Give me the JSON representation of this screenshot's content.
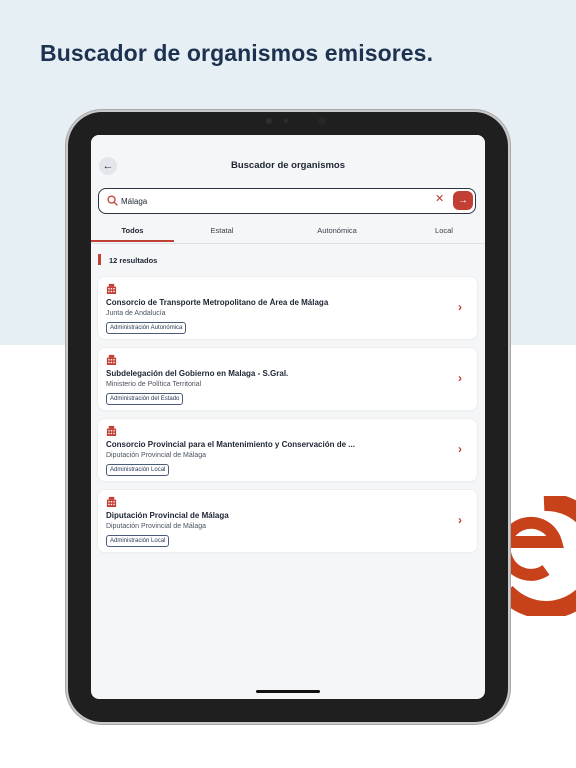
{
  "headline": "Buscador de organismos emisores.",
  "app": {
    "title": "Buscador de organismos",
    "back_icon": "arrow-left-icon"
  },
  "search": {
    "value": "Málaga",
    "placeholder": "",
    "search_icon": "search-icon",
    "clear_icon": "close-icon",
    "go_icon": "arrow-right-icon"
  },
  "tabs": [
    {
      "label": "Todos",
      "active": true
    },
    {
      "label": "Estatal",
      "active": false
    },
    {
      "label": "Autonómica",
      "active": false
    },
    {
      "label": "Local",
      "active": false
    }
  ],
  "results": {
    "count_label": "12 resultados",
    "items": [
      {
        "title": "Consorcio de Transporte Metropolitano de Área de Málaga",
        "subtitle": "Junta de Andalucía",
        "badge": "Administración Autonómica"
      },
      {
        "title": "Subdelegación del Gobierno en Malaga - S.Gral.",
        "subtitle": "Ministerio de Política Territorial",
        "badge": "Administración del Estado"
      },
      {
        "title": "Consorcio Provincial para el Mantenimiento y Conservación de ...",
        "subtitle": "Diputación Provincial de Málaga",
        "badge": "Administración Local"
      },
      {
        "title": "Diputación Provincial de Málaga",
        "subtitle": "Diputación Provincial de Málaga",
        "badge": "Administración Local"
      }
    ]
  },
  "colors": {
    "accent": "#c24033",
    "headline": "#1d3150",
    "background_top": "#e6eff3",
    "badge_border": "#4a5c7a"
  }
}
